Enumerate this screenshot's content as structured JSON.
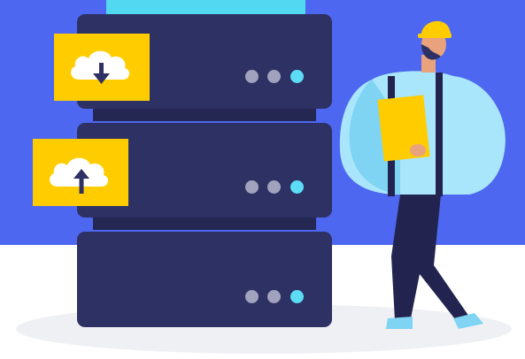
{
  "scene": {
    "description_icons": [
      "cloud-download-icon",
      "cloud-upload-icon"
    ],
    "colors": {
      "backdrop": "#4D67F0",
      "floor": "#EEF0F4",
      "server_body": "#2E3163",
      "server_connector": "#242751",
      "server_top_strip": "#53D8F2",
      "led_grey": "#A1A3BE",
      "led_active": "#5CDCF5",
      "card": "#FFCC00",
      "cloud": "#FFFFFF",
      "arrow": "#2E3163",
      "shirt": "#A9E5FB",
      "shirt_shade": "#7FD3F3",
      "pants": "#22244F",
      "helmet": "#FFCC00",
      "skin": "#E9A37C",
      "beard": "#2E3163",
      "clipboard": "#FFCC00",
      "shoe": "#7FD3F3"
    },
    "servers": [
      {
        "leds": [
          "grey",
          "grey",
          "active"
        ]
      },
      {
        "leds": [
          "grey",
          "grey",
          "active"
        ]
      },
      {
        "leds": [
          "grey",
          "grey",
          "active"
        ]
      }
    ],
    "cards": [
      {
        "icon": "cloud-download-icon"
      },
      {
        "icon": "cloud-upload-icon"
      }
    ]
  }
}
